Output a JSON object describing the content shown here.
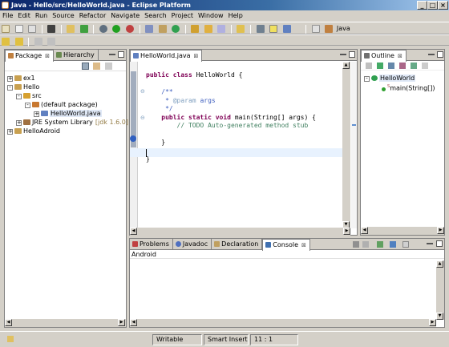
{
  "window": {
    "title": "Java - Hello/src/HelloWorld.java - Eclipse Platform",
    "min": "_",
    "max": "□",
    "close": "×"
  },
  "menu": [
    "File",
    "Edit",
    "Run",
    "Source",
    "Refactor",
    "Navigate",
    "Search",
    "Project",
    "Window",
    "Help"
  ],
  "perspective": {
    "label": "Java"
  },
  "left": {
    "tabs": [
      {
        "label": "Package",
        "close": "⊠"
      },
      {
        "label": "Hierarchy"
      }
    ],
    "tree": [
      {
        "label": "ex1",
        "indent": 0,
        "exp": "+",
        "icon": "project-icon",
        "color": "#c8a050"
      },
      {
        "label": "Hello",
        "indent": 0,
        "exp": "-",
        "icon": "project-icon",
        "color": "#c8a050"
      },
      {
        "label": "src",
        "indent": 1,
        "exp": "-",
        "icon": "source-folder-icon",
        "color": "#d6a030"
      },
      {
        "label": "(default package)",
        "indent": 2,
        "exp": "-",
        "icon": "package-icon",
        "color": "#c87830"
      },
      {
        "label": "HelloWorld.java",
        "indent": 3,
        "exp": "+",
        "icon": "java-file-icon",
        "color": "#6080c0",
        "selected": true
      },
      {
        "label": "JRE System Library",
        "suffix": "[jdk 1.6.0]",
        "indent": 1,
        "exp": "+",
        "icon": "library-icon",
        "color": "#a07040"
      },
      {
        "label": "HelloAdroid",
        "indent": 0,
        "exp": "+",
        "icon": "project-icon",
        "color": "#c8a050"
      }
    ]
  },
  "editor": {
    "tab": "HelloWorld.java",
    "close": "⊠"
  },
  "outline": {
    "tab": "Outline",
    "close": "⊠",
    "items": [
      {
        "label": "HelloWorld",
        "exp": "-"
      },
      {
        "label": "main(String[])",
        "sup": "S"
      }
    ]
  },
  "bottom": {
    "tabs": [
      {
        "label": "Problems"
      },
      {
        "label": "Javadoc"
      },
      {
        "label": "Declaration"
      },
      {
        "label": "Console",
        "active": true,
        "close": "⊠"
      }
    ],
    "console_title": "Android"
  },
  "status": {
    "writable": "Writable",
    "insert": "Smart Insert",
    "position": "11 : 1"
  }
}
